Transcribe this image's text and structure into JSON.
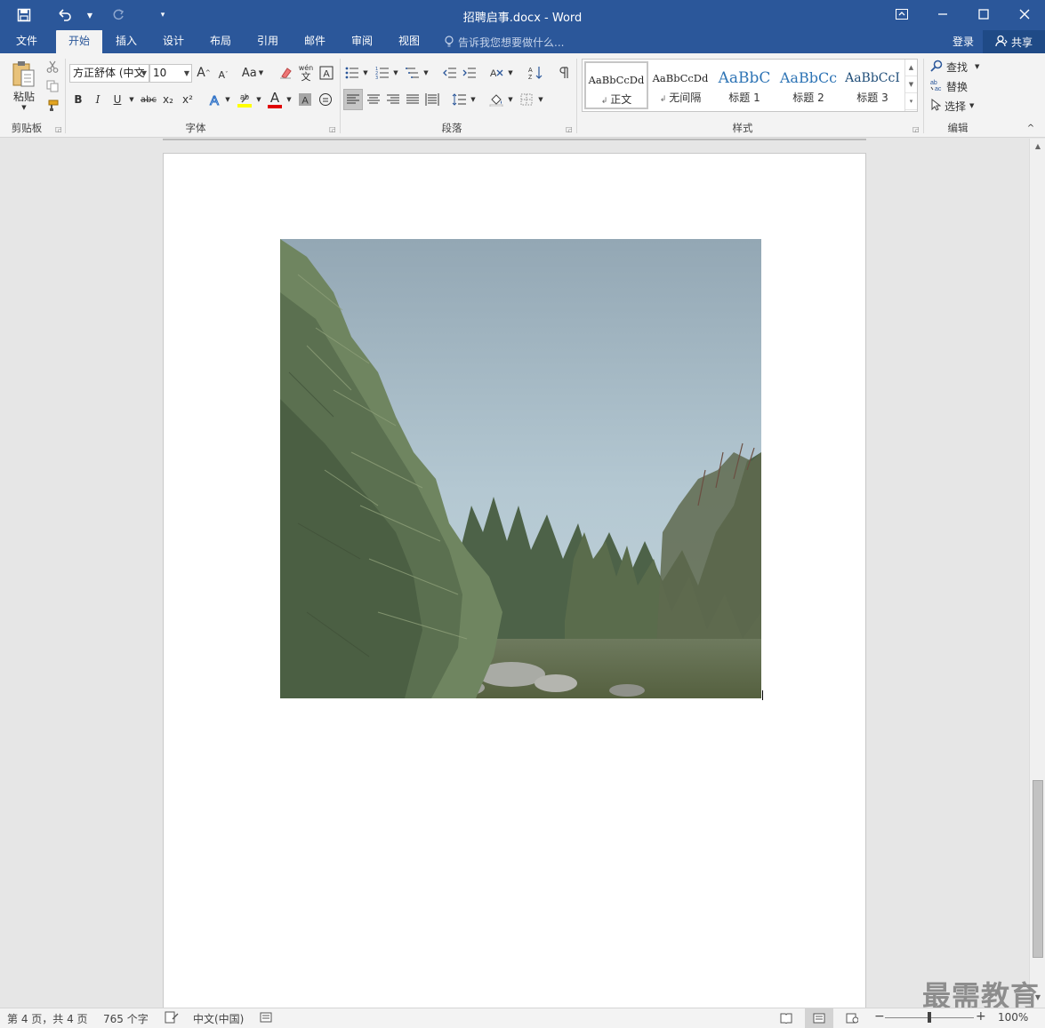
{
  "window": {
    "title": "招聘启事.docx - Word"
  },
  "tabs": [
    {
      "label": "文件"
    },
    {
      "label": "开始"
    },
    {
      "label": "插入"
    },
    {
      "label": "设计"
    },
    {
      "label": "布局"
    },
    {
      "label": "引用"
    },
    {
      "label": "邮件"
    },
    {
      "label": "审阅"
    },
    {
      "label": "视图"
    }
  ],
  "tell_me": "告诉我您想要做什么...",
  "account": {
    "login": "登录",
    "share": "共享"
  },
  "clipboard": {
    "paste": "粘贴",
    "label": "剪贴板"
  },
  "font": {
    "name": "方正舒体 (中文",
    "size": "10",
    "label": "字体",
    "grow": "A",
    "shrink": "A",
    "case": "Aa",
    "bold": "B",
    "italic": "I",
    "underline": "U",
    "strike": "abc",
    "subscript": "x₂",
    "superscript": "x²",
    "color_letter": "A",
    "highlight_color": "#ffff00",
    "font_color": "#e00000",
    "phonetic": "wén",
    "phonetic_char": "文"
  },
  "paragraph": {
    "label": "段落"
  },
  "styles": {
    "label": "样式",
    "items": [
      {
        "sample": "AaBbCcDd",
        "name": "正文"
      },
      {
        "sample": "AaBbCcDd",
        "name": "无间隔"
      },
      {
        "sample": "AaBbC",
        "name": "标题 1"
      },
      {
        "sample": "AaBbCc",
        "name": "标题 2"
      },
      {
        "sample": "AaBbCcI",
        "name": "标题 3"
      }
    ]
  },
  "editing": {
    "label": "编辑",
    "find": "查找",
    "replace": "替换",
    "select": "选择"
  },
  "status": {
    "page": "第 4 页，共 4 页",
    "words": "765 个字",
    "language": "中文(中国)",
    "zoom": "100%"
  },
  "watermark": "最需教育",
  "colors": {
    "accent": "#2b579a",
    "ribbon_bg": "#f3f3f3"
  }
}
